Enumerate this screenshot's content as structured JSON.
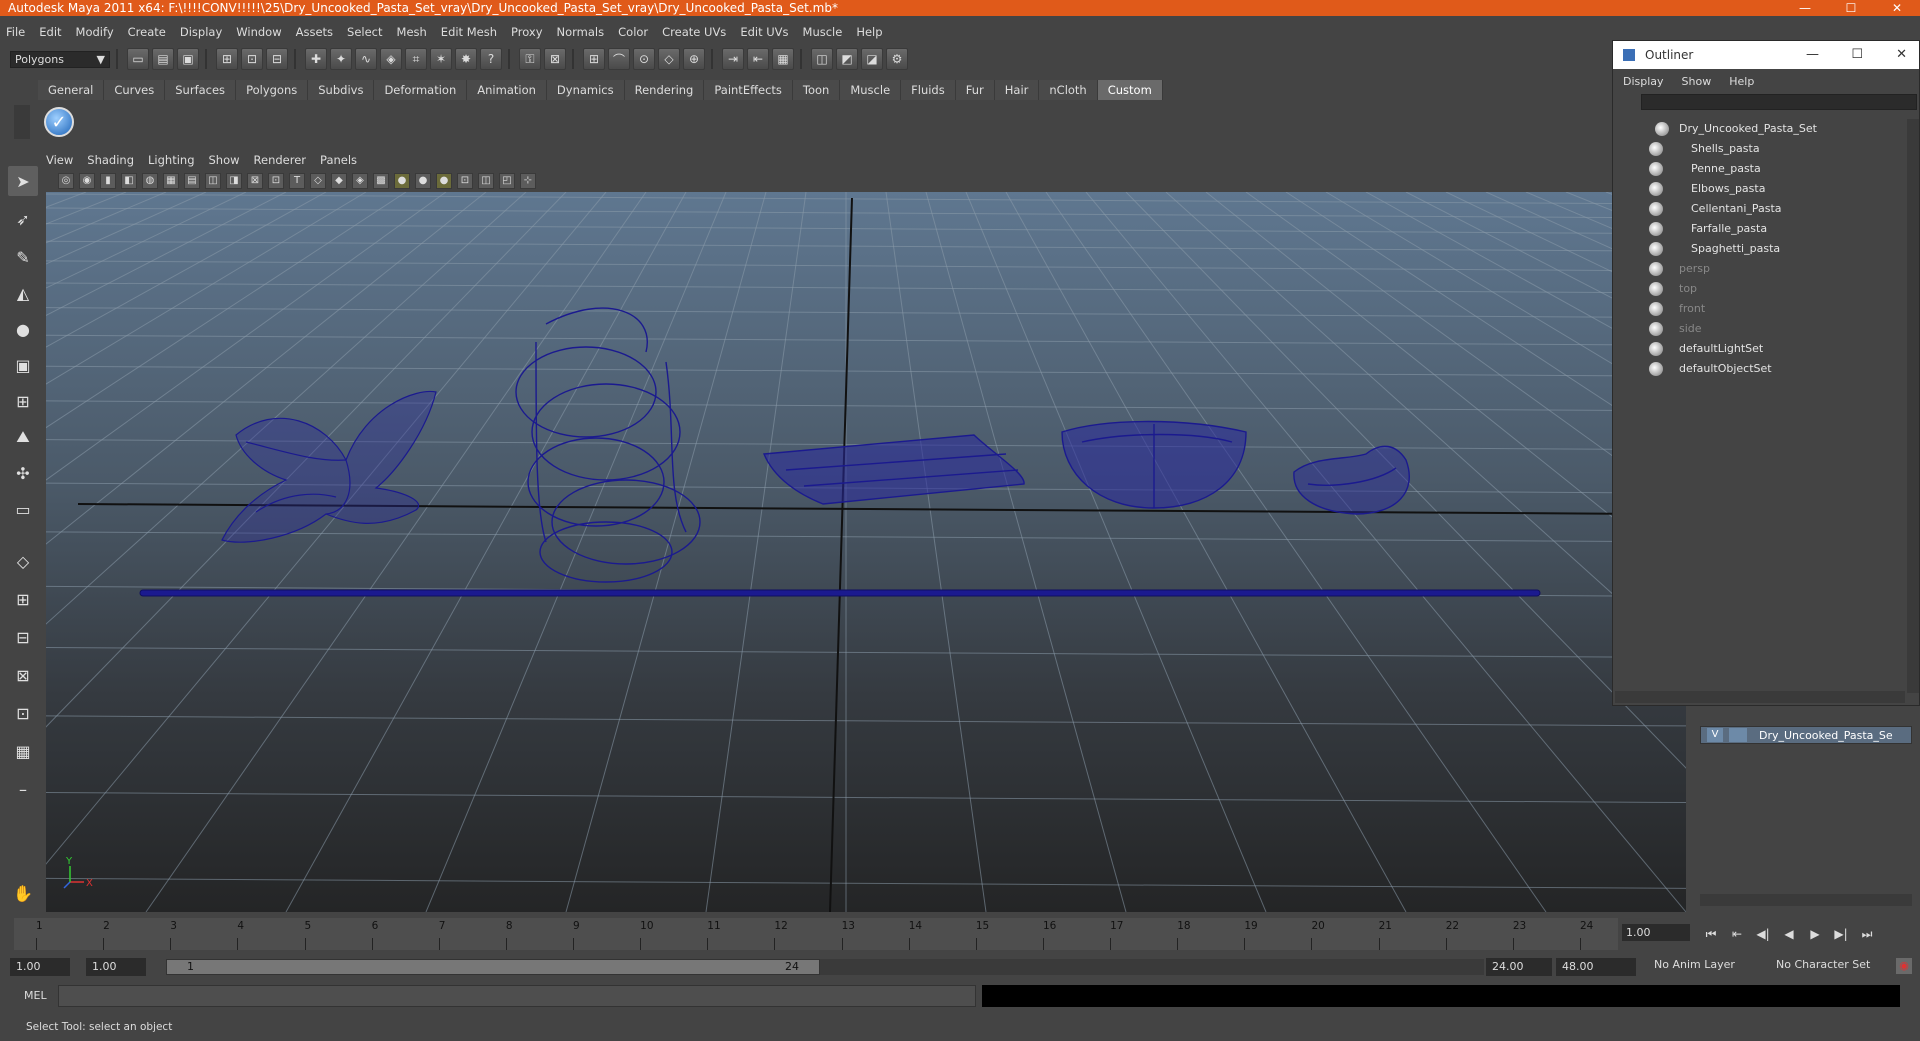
{
  "window": {
    "title": "Autodesk Maya 2011 x64: F:\\!!!!CONV!!!!!\\25\\Dry_Uncooked_Pasta_Set_vray\\Dry_Uncooked_Pasta_Set_vray\\Dry_Uncooked_Pasta_Set.mb*",
    "minimize": "—",
    "maximize": "☐",
    "close": "✕"
  },
  "menubar": [
    "File",
    "Edit",
    "Modify",
    "Create",
    "Display",
    "Window",
    "Assets",
    "Select",
    "Mesh",
    "Edit Mesh",
    "Proxy",
    "Normals",
    "Color",
    "Create UVs",
    "Edit UVs",
    "Muscle",
    "Help"
  ],
  "statusline": {
    "mode": "Polygons",
    "arrow": "▼"
  },
  "shelf_tabs": [
    {
      "label": "General"
    },
    {
      "label": "Curves"
    },
    {
      "label": "Surfaces"
    },
    {
      "label": "Polygons"
    },
    {
      "label": "Subdivs"
    },
    {
      "label": "Deformation"
    },
    {
      "label": "Animation"
    },
    {
      "label": "Dynamics"
    },
    {
      "label": "Rendering"
    },
    {
      "label": "PaintEffects"
    },
    {
      "label": "Toon"
    },
    {
      "label": "Muscle"
    },
    {
      "label": "Fluids"
    },
    {
      "label": "Fur"
    },
    {
      "label": "Hair"
    },
    {
      "label": "nCloth"
    },
    {
      "label": "Custom",
      "active": true
    }
  ],
  "panel_menu": [
    "View",
    "Shading",
    "Lighting",
    "Show",
    "Renderer",
    "Panels"
  ],
  "viewport": {
    "axis_label": "X",
    "axis_label_y": "Y"
  },
  "timeline": {
    "ticks": [
      "1",
      "2",
      "3",
      "4",
      "5",
      "6",
      "7",
      "8",
      "9",
      "10",
      "11",
      "12",
      "13",
      "14",
      "15",
      "16",
      "17",
      "18",
      "19",
      "20",
      "21",
      "22",
      "23",
      "24"
    ],
    "current_frame": "1.00"
  },
  "playback": [
    "⏮",
    "⇤",
    "◀|",
    "◀",
    "▶",
    "▶|",
    "⏭"
  ],
  "range": {
    "start": "1.00",
    "playback_start": "1.00",
    "slider_low": "1",
    "slider_high": "24",
    "playback_end": "24.00",
    "end": "48.00",
    "anim_layer": "No Anim Layer",
    "character_set": "No Character Set"
  },
  "cmdline": {
    "label": "MEL"
  },
  "helpline": {
    "text": "Select Tool: select an object"
  },
  "outliner": {
    "title": "Outliner",
    "menu": [
      "Display",
      "Show",
      "Help"
    ],
    "items": [
      {
        "label": "Dry_Uncooked_Pasta_Set",
        "indent": 0,
        "dim": false
      },
      {
        "label": "Shells_pasta",
        "indent": 1,
        "dim": false
      },
      {
        "label": "Penne_pasta",
        "indent": 1,
        "dim": false
      },
      {
        "label": "Elbows_pasta",
        "indent": 1,
        "dim": false
      },
      {
        "label": "Cellentani_Pasta",
        "indent": 1,
        "dim": false
      },
      {
        "label": "Farfalle_pasta",
        "indent": 1,
        "dim": false
      },
      {
        "label": "Spaghetti_pasta",
        "indent": 1,
        "dim": false
      },
      {
        "label": "persp",
        "indent": 0,
        "dim": true
      },
      {
        "label": "top",
        "indent": 0,
        "dim": true
      },
      {
        "label": "front",
        "indent": 0,
        "dim": true
      },
      {
        "label": "side",
        "indent": 0,
        "dim": true
      },
      {
        "label": "defaultLightSet",
        "indent": 0,
        "dim": false
      },
      {
        "label": "defaultObjectSet",
        "indent": 0,
        "dim": false
      }
    ]
  },
  "layer": {
    "visible": "V",
    "name": "Dry_Uncooked_Pasta_Se"
  }
}
